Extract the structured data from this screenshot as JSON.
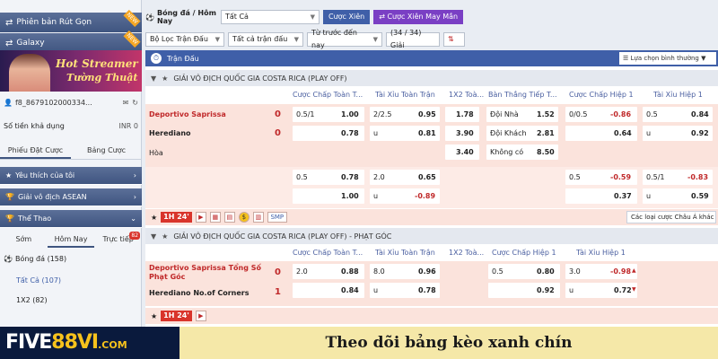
{
  "sidebar": {
    "btn_short": "Phiên bản Rút Gọn",
    "btn_galaxy": "Galaxy",
    "new_badge": "NEW",
    "banner_line1": "Hot Streamer",
    "banner_line2": "Tường Thuật",
    "account_id": "f8_8679102000334...",
    "balance_label": "Số tiền khả dụng",
    "balance_value": "INR 0",
    "tabs": [
      "Phiếu Đặt Cược",
      "Bảng Cược"
    ],
    "sections": [
      "Yêu thích của tôi",
      "Giải vô địch ASEAN",
      "Thể Thao"
    ],
    "time_tabs": [
      "Sớm",
      "Hôm Nay",
      "Trực tiếp"
    ],
    "live_count": "82",
    "sport": "Bóng đá",
    "sport_count": "(158)",
    "all_label": "Tất Cả",
    "all_count": "(107)",
    "x12_label": "1X2",
    "x12_count": "(82)"
  },
  "topbar": {
    "title": "Bóng đá / Hôm Nay",
    "select_all": "Tất Cả",
    "btn_xien": "Cược Xiên",
    "btn_xien_lucky": "Cược Xiên May Mắn"
  },
  "filterbar": {
    "f1": "Bộ Lọc Trận Đấu",
    "f2": "Tất cả trận đấu",
    "f3": "Từ trước đến nay",
    "count": "(34 / 34) Giải"
  },
  "main": {
    "header": "Trận Đấu",
    "sort_select": "Lựa chọn bình thường",
    "league1": "GIẢI VÔ ĐỊCH QUỐC GIA COSTA RICA (PLAY OFF)",
    "league2": "GIẢI VÔ ĐỊCH QUỐC GIA COSTA RICA (PLAY OFF) - PHẠT GÓC",
    "cols1": [
      "Cược Chấp Toàn T...",
      "Tài Xỉu Toàn Trận",
      "1X2 Toà...",
      "Bàn Thắng Tiếp T...",
      "Cược Chấp Hiệp 1",
      "Tài Xỉu Hiệp 1"
    ],
    "cols2": [
      "Cược Chấp Toàn T...",
      "Tài Xỉu Toàn Trận",
      "1X2 Toà...",
      "Cược Chấp Hiệp 1",
      "Tài Xỉu Hiệp 1"
    ],
    "match1": {
      "home": "Deportivo Saprissa",
      "away": "Herediano",
      "draw": "Hòa",
      "home_score": "0",
      "away_score": "0",
      "hdp_line": "0.5/1",
      "hdp_home": "1.00",
      "hdp_away": "0.78",
      "ou_line": "2/2.5",
      "ou_over": "0.95",
      "ou_u": "u",
      "ou_under": "0.81",
      "x12_home": "1.78",
      "x12_away": "3.90",
      "x12_draw": "3.40",
      "next_home_label": "Đội Nhà",
      "next_home": "1.52",
      "next_away_label": "Đội Khách",
      "next_away": "2.81",
      "next_none_label": "Không có",
      "next_none": "8.50",
      "h1_line": "0/0.5",
      "h1_home": "-0.86",
      "h1_away": "0.64",
      "h1ou_line": "0.5",
      "h1ou_over": "0.84",
      "h1ou_u": "u",
      "h1ou_under": "0.92",
      "alt_hdp_line": "0.5",
      "alt_hdp_home": "0.78",
      "alt_hdp_away": "1.00",
      "alt_ou_line": "2.0",
      "alt_ou_over": "0.65",
      "alt_ou_u": "u",
      "alt_ou_under": "-0.89",
      "alt_h1_line": "0.5",
      "alt_h1_home": "-0.59",
      "alt_h1_away": "0.37",
      "alt_h1ou_line": "0.5/1",
      "alt_h1ou_over": "-0.83",
      "alt_h1ou_u": "u",
      "alt_h1ou_under": "0.59",
      "time": "1H 24'",
      "smp": "SMP",
      "other_bets": "Các loại cược Châu Á khác"
    },
    "match2": {
      "home": "Deportivo Saprissa Tổng Số Phạt Góc",
      "away": "Herediano No.of Corners",
      "home_score": "0",
      "away_score": "1",
      "hdp_line": "2.0",
      "hdp_home": "0.88",
      "hdp_away": "0.84",
      "ou_line": "8.0",
      "ou_over": "0.96",
      "ou_u": "u",
      "ou_under": "0.78",
      "h1_line": "0.5",
      "h1_home": "0.80",
      "h1_away": "0.92",
      "h1ou_line": "3.0",
      "h1ou_over": "-0.98",
      "h1ou_u": "u",
      "h1ou_under": "0.72",
      "time": "1H 24'"
    }
  },
  "brand": {
    "logo_a": "FIVE",
    "logo_b": "88VI",
    "logo_c": ".COM",
    "caption": "Theo dõi bảng kèo xanh chín"
  },
  "colors": {
    "nav_blue": "#3f5fa8",
    "accent_red": "#c0292a",
    "row_pink": "#fbe3dc",
    "brand_yellow": "#f5e8a8"
  }
}
